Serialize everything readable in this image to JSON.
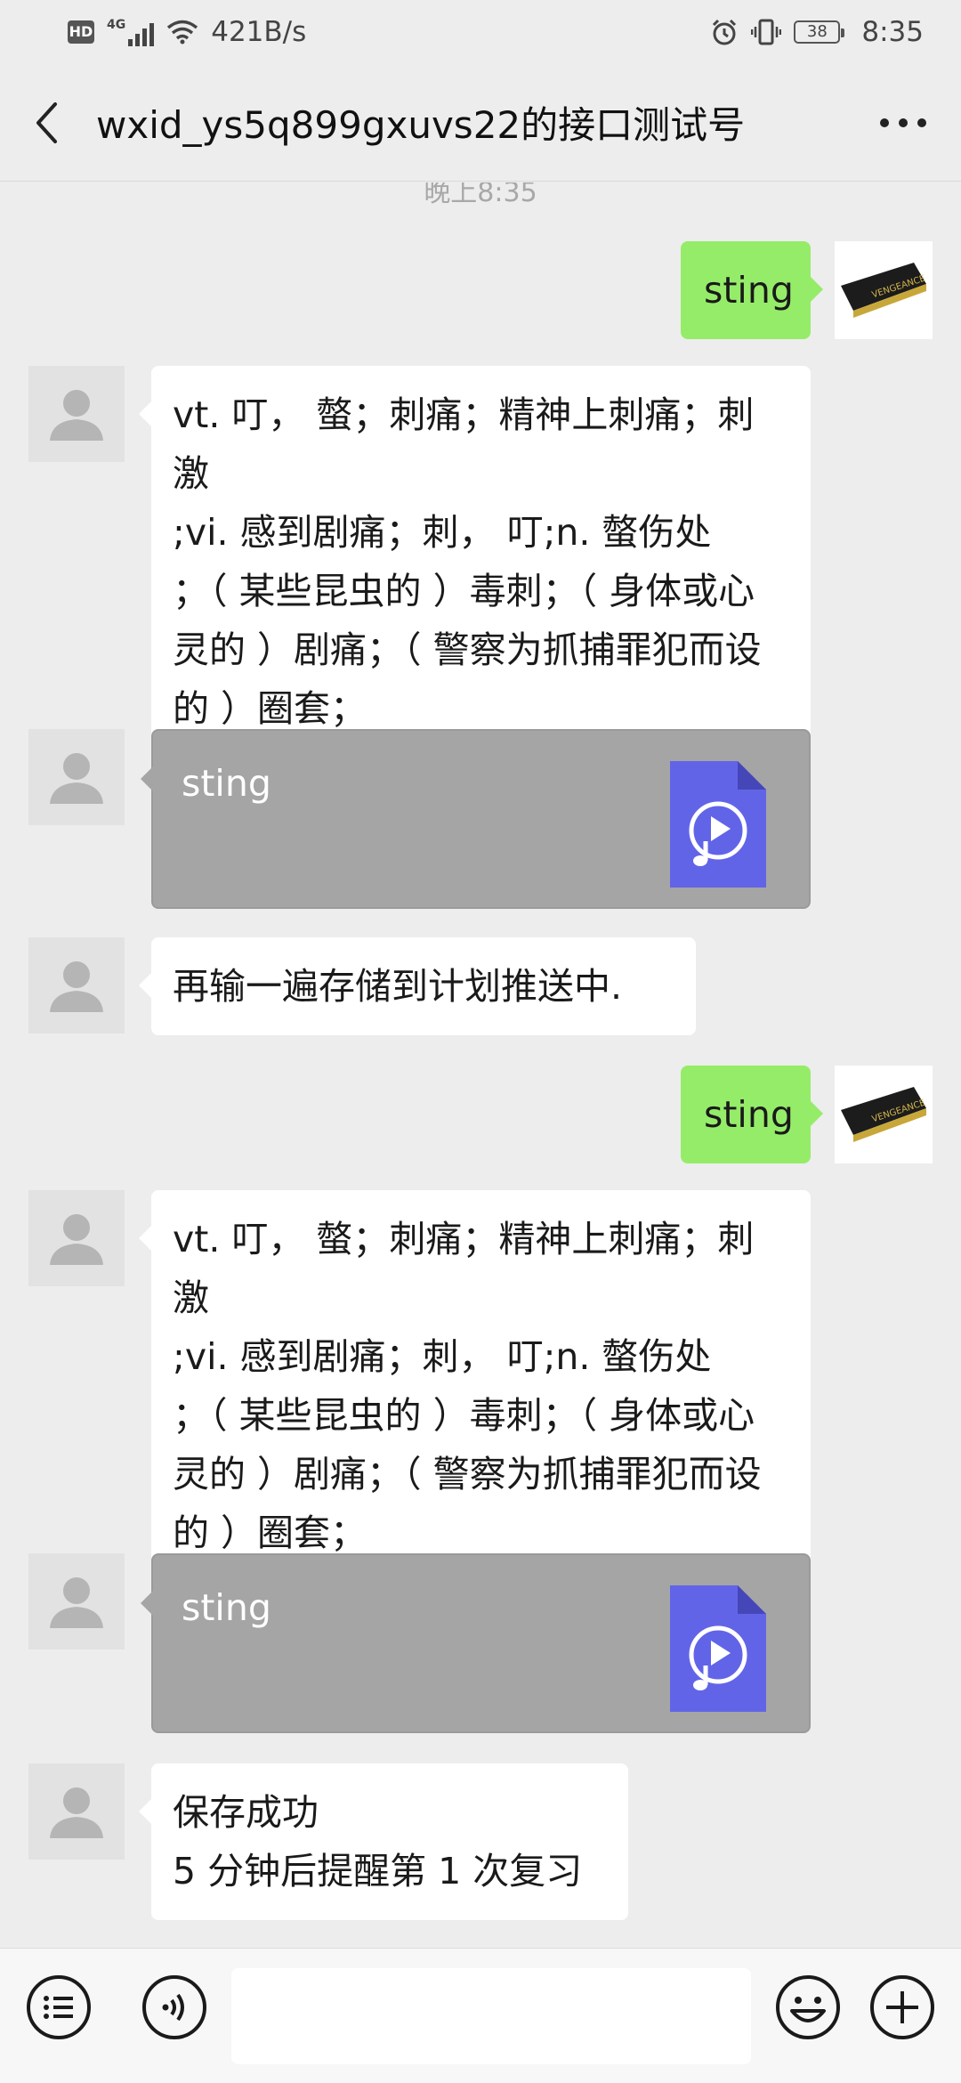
{
  "status_bar": {
    "hd": "HD",
    "network": "4G",
    "speed": "421B/s",
    "battery": "38",
    "time": "8:35"
  },
  "header": {
    "title": "wxid_ys5q899gxuvs22的接口测试号"
  },
  "chat": {
    "time_label": "晚上8:35",
    "messages": [
      {
        "side": "right",
        "type": "text",
        "text": "sting"
      },
      {
        "side": "left",
        "type": "text",
        "lines": [
          "vt. 叮， 螫；刺痛；精神上刺痛；刺激",
          ";vi. 感到剧痛；刺， 叮;n. 螫伤处",
          "；（ 某些昆虫的 ）毒刺；（ 身体或心",
          "灵的 ）剧痛；（ 警察为抓捕罪犯而设",
          "的 ）圈套；"
        ]
      },
      {
        "side": "left",
        "type": "music",
        "title": "sting"
      },
      {
        "side": "left",
        "type": "text",
        "lines": [
          "再输一遍存储到计划推送中."
        ]
      },
      {
        "side": "right",
        "type": "text",
        "text": "sting"
      },
      {
        "side": "left",
        "type": "text",
        "lines": [
          "vt. 叮， 螫；刺痛；精神上刺痛；刺激",
          ";vi. 感到剧痛；刺， 叮;n. 螫伤处",
          "；（ 某些昆虫的 ）毒刺；（ 身体或心",
          "灵的 ）剧痛；（ 警察为抓捕罪犯而设",
          "的 ）圈套；"
        ]
      },
      {
        "side": "left",
        "type": "music",
        "title": "sting"
      },
      {
        "side": "left",
        "type": "text",
        "lines": [
          "保存成功",
          "5 分钟后提醒第 1 次复习"
        ]
      }
    ],
    "self_avatar_text": "VENGEANCE"
  },
  "colors": {
    "self_bubble": "#95ec69",
    "other_bubble": "#ffffff",
    "music_bubble": "#a5a5a5",
    "music_icon": "#6264e8",
    "background": "#ededed"
  },
  "icons": {
    "back": "chevron-left-icon",
    "more": "more-dots-icon",
    "menu": "list-menu-icon",
    "voice": "voice-icon",
    "emoji": "emoji-icon",
    "add": "plus-circle-icon"
  }
}
